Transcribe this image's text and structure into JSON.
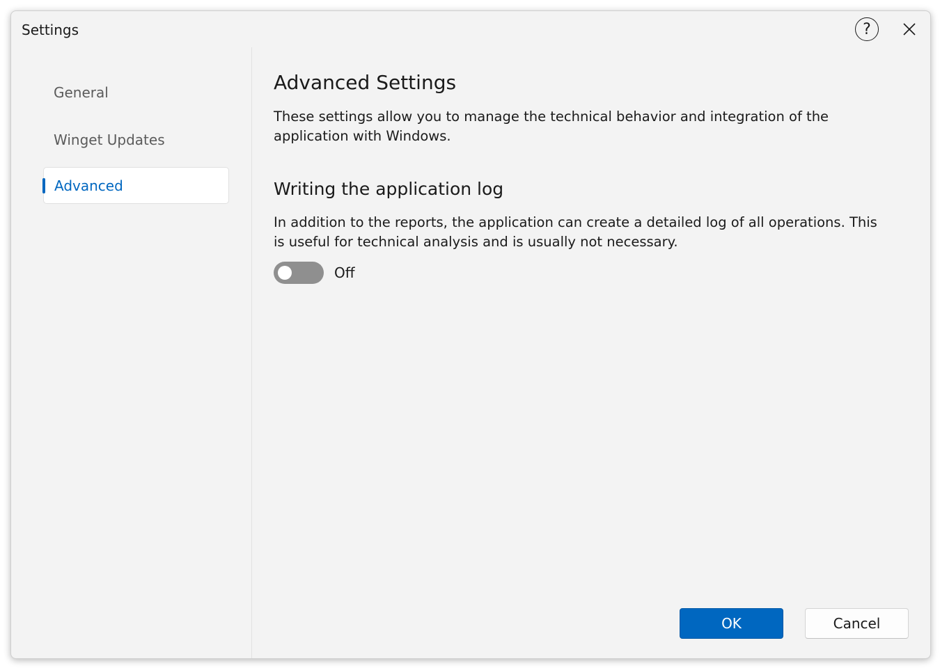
{
  "window": {
    "title": "Settings",
    "help_symbol": "?",
    "help_icon": "question-circle-icon",
    "close_icon": "close-x-icon"
  },
  "sidebar": {
    "items": [
      {
        "label": "General",
        "active": false
      },
      {
        "label": "Winget Updates",
        "active": false
      },
      {
        "label": "Advanced",
        "active": true
      }
    ]
  },
  "main": {
    "heading": "Advanced Settings",
    "description": "These settings allow you to manage the technical behavior and integration of the application with Windows.",
    "log_section": {
      "heading": "Writing the application log",
      "description": "In addition to the reports, the application can create a detailed log of all operations. This is useful for technical analysis and is usually not necessary.",
      "toggle_state": false,
      "toggle_label": "Off"
    }
  },
  "footer": {
    "ok_label": "OK",
    "cancel_label": "Cancel"
  },
  "colors": {
    "accent": "#0067c0",
    "window_bg": "#f3f3f3",
    "toggle_off": "#8f8f8f"
  }
}
